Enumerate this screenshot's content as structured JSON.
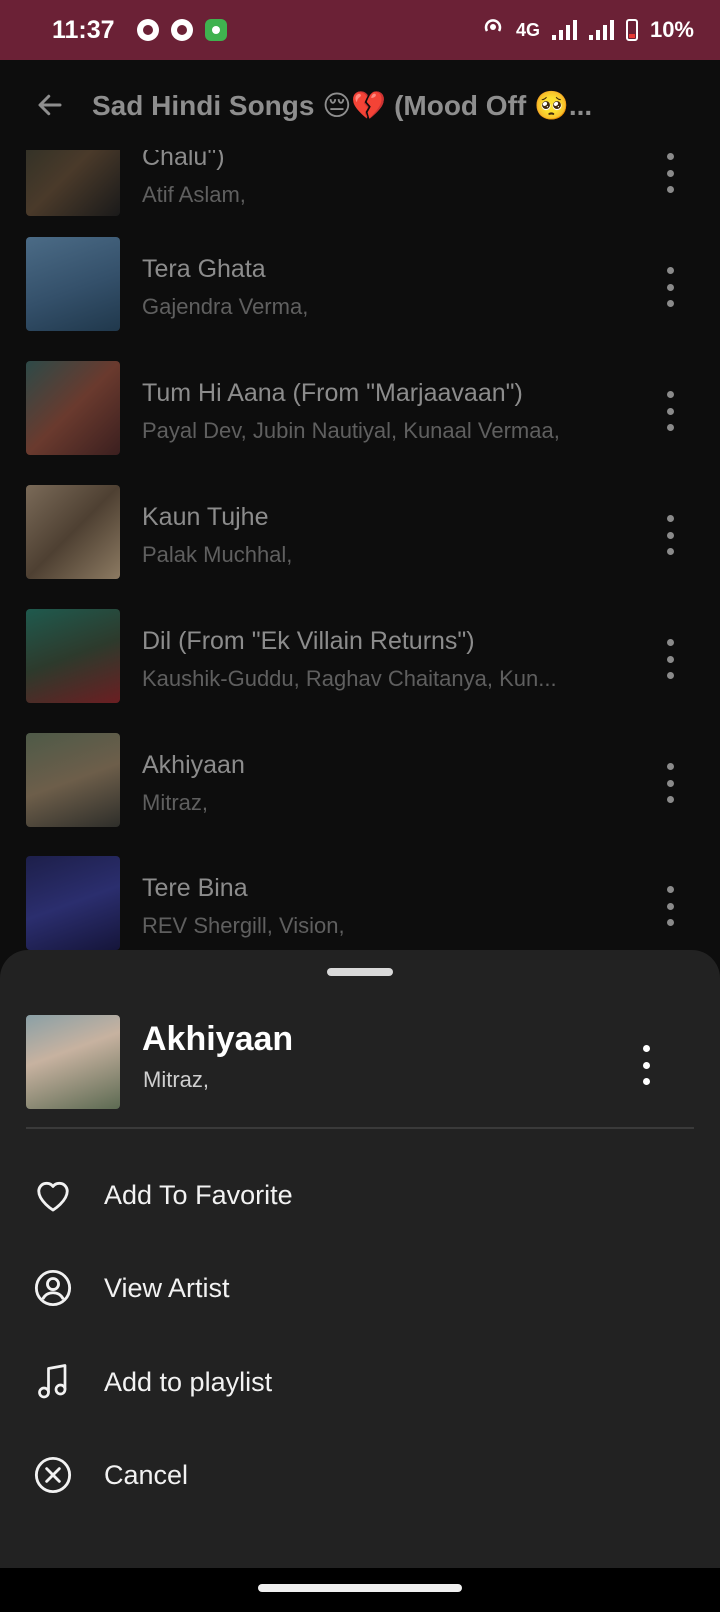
{
  "status_bar": {
    "time": "11:37",
    "network": "4G",
    "battery": "10%",
    "bg_color": "#6b2136"
  },
  "header": {
    "title": "Sad Hindi Songs 😔💔  (Mood Off 🥺..."
  },
  "songs": [
    {
      "title": "Chalu\")",
      "artist": "Atif Aslam,"
    },
    {
      "title": "Tera Ghata",
      "artist": "Gajendra Verma,"
    },
    {
      "title": "Tum Hi Aana (From \"Marjaavaan\")",
      "artist": "Payal Dev, Jubin Nautiyal, Kunaal Vermaa,"
    },
    {
      "title": "Kaun Tujhe",
      "artist": "Palak Muchhal,"
    },
    {
      "title": "Dil (From \"Ek Villain Returns\")",
      "artist": "Kaushik-Guddu, Raghav Chaitanya, Kun..."
    },
    {
      "title": "Akhiyaan",
      "artist": "Mitraz,"
    },
    {
      "title": "Tere Bina",
      "artist": "REV Shergill, Vision,"
    }
  ],
  "sheet": {
    "song_title": "Akhiyaan",
    "song_artist": "Mitraz,",
    "options": [
      {
        "label": "Add To Favorite",
        "icon": "heart-icon"
      },
      {
        "label": "View Artist",
        "icon": "user-circle-icon"
      },
      {
        "label": "Add to playlist",
        "icon": "music-note-icon"
      },
      {
        "label": "Cancel",
        "icon": "cancel-circle-icon"
      }
    ]
  }
}
